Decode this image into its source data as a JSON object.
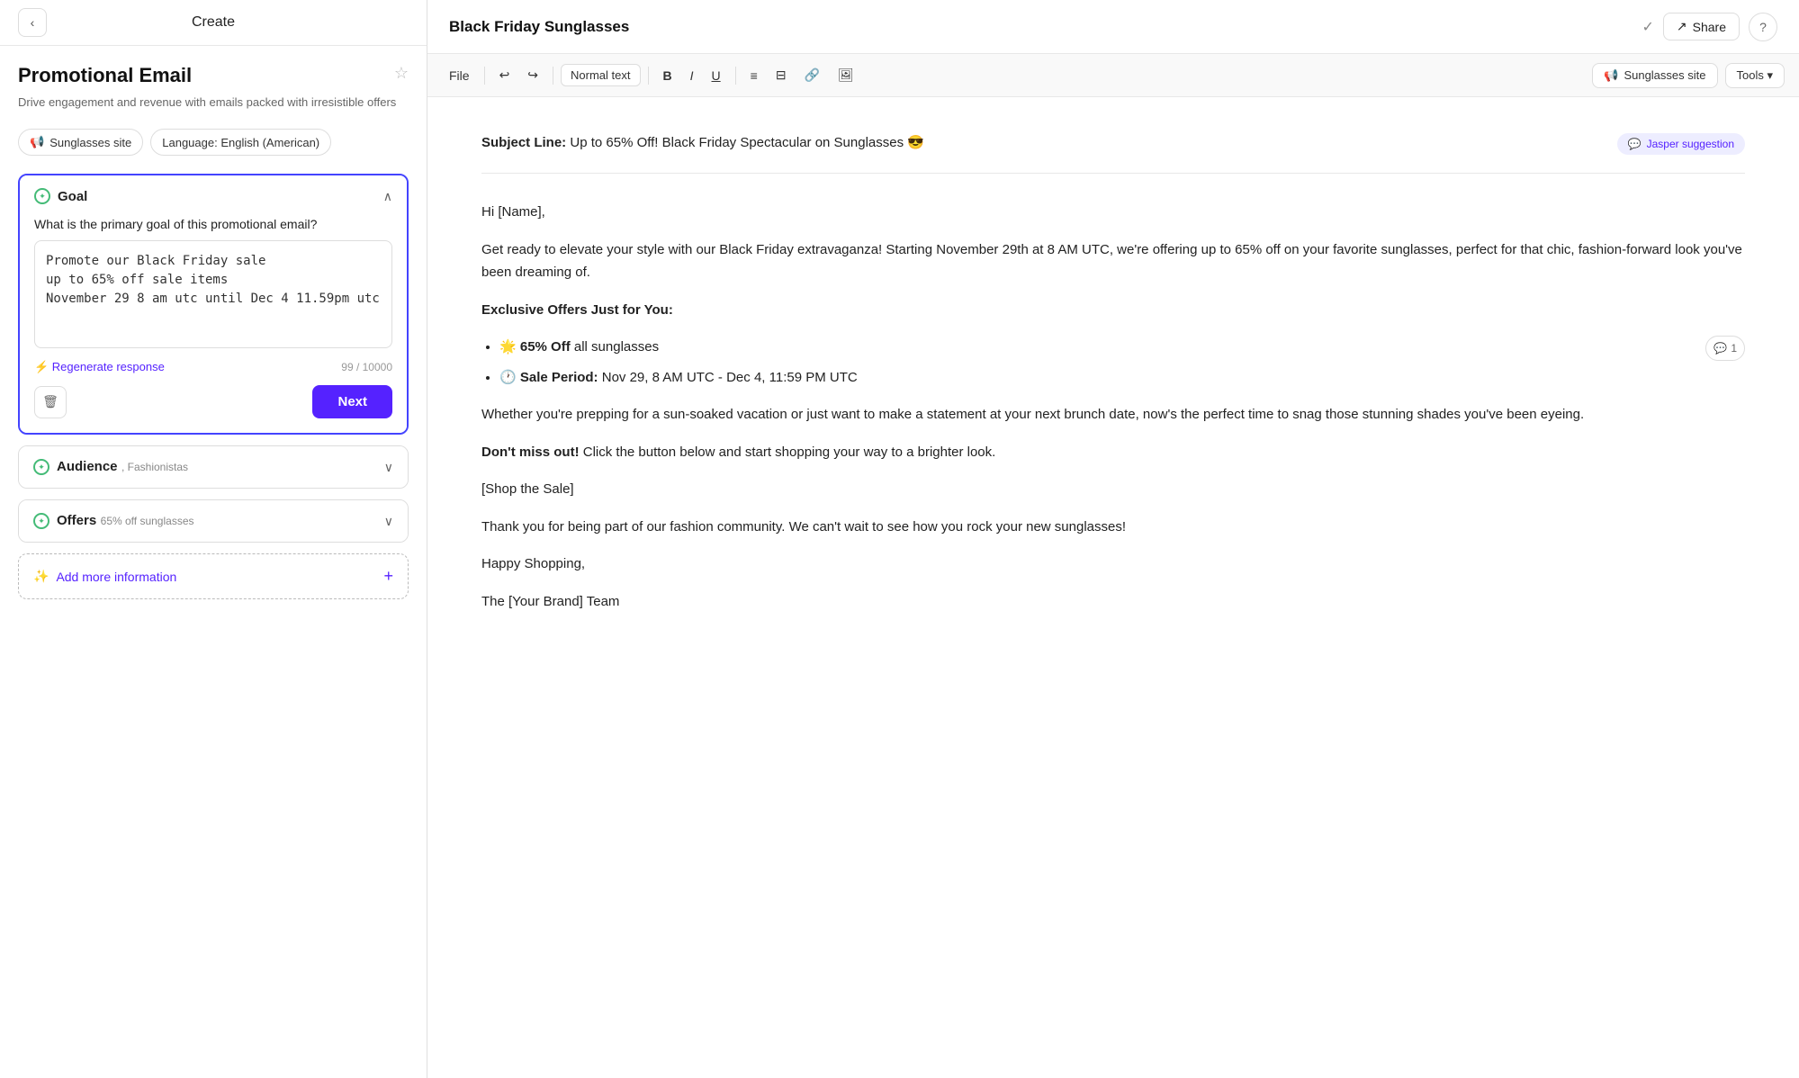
{
  "leftPanel": {
    "header": {
      "back_label": "‹",
      "title": "Create"
    },
    "promoTitle": "Promotional Email",
    "promoDesc": "Drive engagement and revenue with emails packed with irresistible offers",
    "tags": [
      {
        "id": "site",
        "icon": "📢",
        "label": "Sunglasses site"
      },
      {
        "id": "lang",
        "icon": "",
        "label": "Language: English (American)"
      }
    ],
    "goalSection": {
      "title": "Goal",
      "question": "What is the primary goal of this promotional email?",
      "textareaValue": "Promote our Black Friday sale\nup to 65% off sale items\nNovember 29 8 am utc until Dec 4 11.59pm utc",
      "charCount": "99 / 10000",
      "regenerateLabel": "⚡ Regenerate response",
      "nextLabel": "Next"
    },
    "audienceSection": {
      "title": "Audience",
      "subtitle": ", Fashionistas"
    },
    "offersSection": {
      "title": "Offers",
      "subtitle": "65% off sunglasses"
    },
    "addMore": {
      "label": "Add more information"
    }
  },
  "rightPanel": {
    "topbar": {
      "title": "Black Friday Sunglasses",
      "shareLabel": "Share",
      "toolsLabel": "Tools"
    },
    "toolbar": {
      "file": "File",
      "undo": "↩",
      "redo": "↪",
      "format": "Normal text",
      "bold": "B",
      "italic": "I",
      "underline": "U",
      "bulletList": "≡",
      "numberedList": "≡",
      "link": "🔗",
      "image": "🖼",
      "siteLabel": "Sunglasses site",
      "toolsLabel": "Tools ▾"
    },
    "editor": {
      "jasperBadge": "Jasper suggestion",
      "subjectLineLabel": "Subject Line:",
      "subjectLineText": "Up to 65% Off! Black Friday Spectacular on Sunglasses 😎",
      "greeting": "Hi [Name],",
      "para1": "Get ready to elevate your style with our Black Friday extravaganza! Starting November 29th at 8 AM UTC, we're offering up to 65% off on your favorite sunglasses, perfect for that chic, fashion-forward look you've been dreaming of.",
      "exclusiveHeading": "Exclusive Offers Just for You:",
      "offer1": "🌟 65% Off all sunglasses",
      "offer1bold": "65% Off",
      "offer2": "🕐 Sale Period: Nov 29, 8 AM UTC - Dec 4, 11:59 PM UTC",
      "offer2bold": "Sale Period:",
      "para2": "Whether you're prepping for a sun-soaked vacation or just want to make a statement at your next brunch date, now's the perfect time to snag those stunning shades you've been eyeing.",
      "dontMiss": "Don't miss out!",
      "para3tail": " Click the button below and start shopping your way to a brighter look.",
      "shopSale": "[Shop the Sale]",
      "para4": "Thank you for being part of our fashion community. We can't wait to see how you rock your new sunglasses!",
      "happyShopping": "Happy Shopping,",
      "signature": "The [Your Brand] Team",
      "commentCount": "1"
    }
  }
}
